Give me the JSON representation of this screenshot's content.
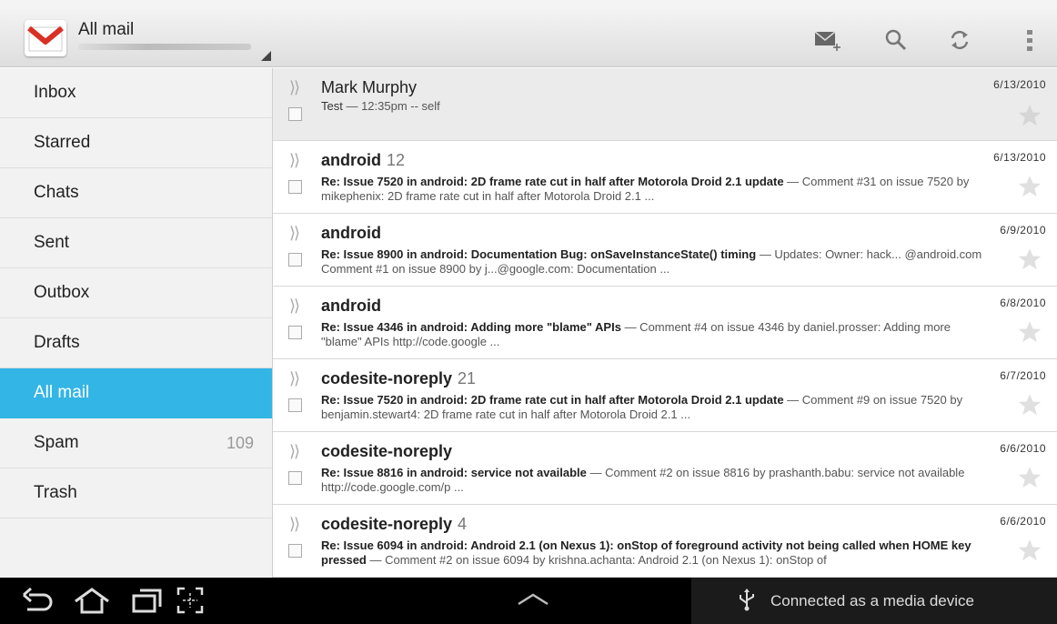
{
  "app": {
    "title": "All mail",
    "account": ""
  },
  "toolbar": {
    "icons": [
      "compose-icon",
      "search-icon",
      "refresh-icon",
      "overflow-menu-icon"
    ]
  },
  "sidebar": {
    "items": [
      {
        "label": "Inbox",
        "count": ""
      },
      {
        "label": "Starred",
        "count": ""
      },
      {
        "label": "Chats",
        "count": ""
      },
      {
        "label": "Sent",
        "count": ""
      },
      {
        "label": "Outbox",
        "count": ""
      },
      {
        "label": "Drafts",
        "count": ""
      },
      {
        "label": "All mail",
        "count": ""
      },
      {
        "label": "Spam",
        "count": "109"
      },
      {
        "label": "Trash",
        "count": ""
      }
    ],
    "selected": "All mail"
  },
  "messages": [
    {
      "sender": "Mark Murphy",
      "count": "",
      "date": "6/13/2010",
      "subject": "Test",
      "snippet": " — 12:35pm -- self",
      "unread": false
    },
    {
      "sender": "android",
      "count": "12",
      "date": "6/13/2010",
      "subject": "Re: Issue 7520 in android: 2D frame rate cut in half after Motorola Droid 2.1 update",
      "snippet": " — Comment #31 on issue 7520 by mikephenix: 2D frame rate cut in half after Motorola Droid 2.1 ...",
      "unread": true
    },
    {
      "sender": "android",
      "count": "",
      "date": "6/9/2010",
      "subject": "Re: Issue 8900 in android: Documentation Bug: onSaveInstanceState() timing",
      "snippet": " — Updates: Owner: hack... @android.com Comment #1 on issue 8900 by j...@google.com: Documentation ...",
      "unread": true
    },
    {
      "sender": "android",
      "count": "",
      "date": "6/8/2010",
      "subject": "Re: Issue 4346 in android: Adding more \"blame\" APIs",
      "snippet": " — Comment #4 on issue 4346 by daniel.prosser: Adding more \"blame\" APIs http://code.google ...",
      "unread": true
    },
    {
      "sender": "codesite-noreply",
      "count": "21",
      "date": "6/7/2010",
      "subject": "Re: Issue 7520 in android: 2D frame rate cut in half after Motorola Droid 2.1 update",
      "snippet": " — Comment #9 on issue 7520 by benjamin.stewart4: 2D frame rate cut in half after Motorola Droid 2.1 ...",
      "unread": true
    },
    {
      "sender": "codesite-noreply",
      "count": "",
      "date": "6/6/2010",
      "subject": "Re: Issue 8816 in android: service not available",
      "snippet": " — Comment #2 on issue 8816 by prashanth.babu: service not available http://code.google.com/p ...",
      "unread": true
    },
    {
      "sender": "codesite-noreply",
      "count": "4",
      "date": "6/6/2010",
      "subject": "Re: Issue 6094 in android: Android 2.1 (on Nexus 1): onStop of foreground activity not being called when HOME key pressed",
      "snippet": " — Comment #2 on issue 6094 by krishna.achanta: Android 2.1 (on Nexus 1): onStop of",
      "unread": true
    }
  ],
  "navbar": {
    "buttons": [
      "back-icon",
      "home-icon",
      "recent-apps-icon",
      "screenshot-icon"
    ],
    "notification": "Connected as a media device",
    "notification_icon": "usb-icon"
  },
  "colors": {
    "accent": "#33b5e5",
    "navbar": "#000000"
  }
}
